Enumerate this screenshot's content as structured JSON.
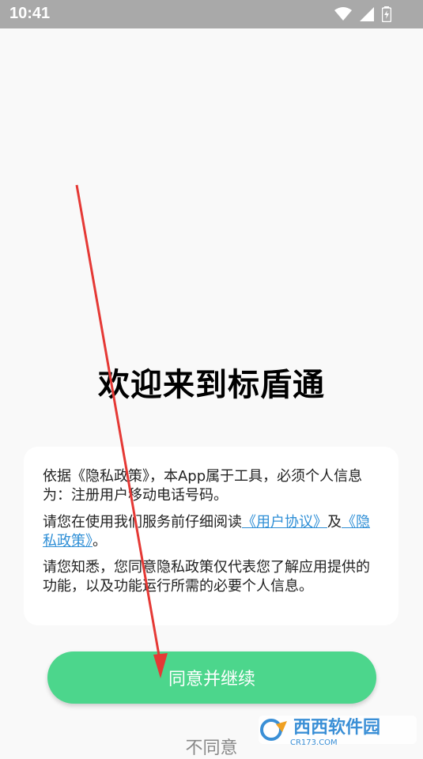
{
  "status_bar": {
    "time": "10:41",
    "icons": [
      "wifi-icon",
      "cellular-signal-icon",
      "battery-icon"
    ]
  },
  "welcome_title": "欢迎来到标盾通",
  "privacy_card": {
    "para1": "依据《隐私政策》，本App属于工具，必须个人信息为：注册用户移动电话号码。",
    "para2_prefix": "请您在使用我们服务前仔细阅读",
    "user_agreement_link": "《用户协议》",
    "para2_mid": "及",
    "privacy_policy_link": "《隐私政策》",
    "para2_suffix": "。",
    "para3": "请您知悉，您同意隐私政策仅代表您了解应用提供的功能，以及功能运行所需的必要个人信息。"
  },
  "buttons": {
    "agree_label": "同意并继续",
    "disagree_label": "不同意"
  },
  "watermark": {
    "brand": "西西软件园",
    "site": "CR173.COM"
  },
  "colors": {
    "agree_button": "#4cd68c",
    "link": "#2f8fd6",
    "arrow": "#e53935",
    "status_bar": "#a9a9a9"
  }
}
